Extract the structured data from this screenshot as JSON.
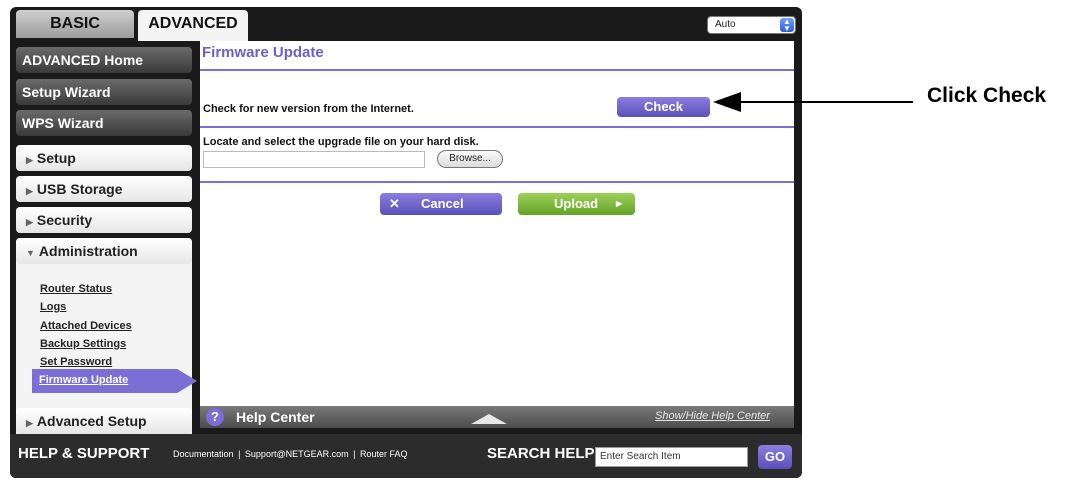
{
  "tabs": {
    "basic": "BASIC",
    "advanced": "ADVANCED"
  },
  "language_select": {
    "value": "Auto"
  },
  "sidebar": {
    "advanced_home": "ADVANCED Home",
    "setup_wizard": "Setup Wizard",
    "wps_wizard": "WPS Wizard",
    "setup": "Setup",
    "usb_storage": "USB Storage",
    "security": "Security",
    "administration": "Administration",
    "admin_items": [
      "Router Status",
      "Logs",
      "Attached Devices",
      "Backup Settings",
      "Set Password"
    ],
    "active_item": "Firmware Update",
    "advanced_setup": "Advanced Setup"
  },
  "main": {
    "title": "Firmware Update",
    "check_label": "Check for new version from the Internet.",
    "check_button": "Check",
    "locate_label": "Locate and select the upgrade file on your hard disk.",
    "file_value": "",
    "browse_button": "Browse...",
    "cancel_button": "Cancel",
    "upload_button": "Upload"
  },
  "help_center": {
    "title": "Help Center",
    "toggle": "Show/Hide Help Center"
  },
  "support": {
    "title": "HELP & SUPPORT",
    "links": [
      "Documentation",
      "Support@NETGEAR.com",
      "Router FAQ"
    ],
    "search_title": "SEARCH HELP",
    "search_placeholder": "Enter Search Item",
    "go_button": "GO"
  },
  "callout": {
    "text": "Click Check"
  },
  "colors": {
    "accent": "#7b6fd6",
    "upload_green": "#7fbf3a",
    "dark": "#1a1a1a"
  }
}
